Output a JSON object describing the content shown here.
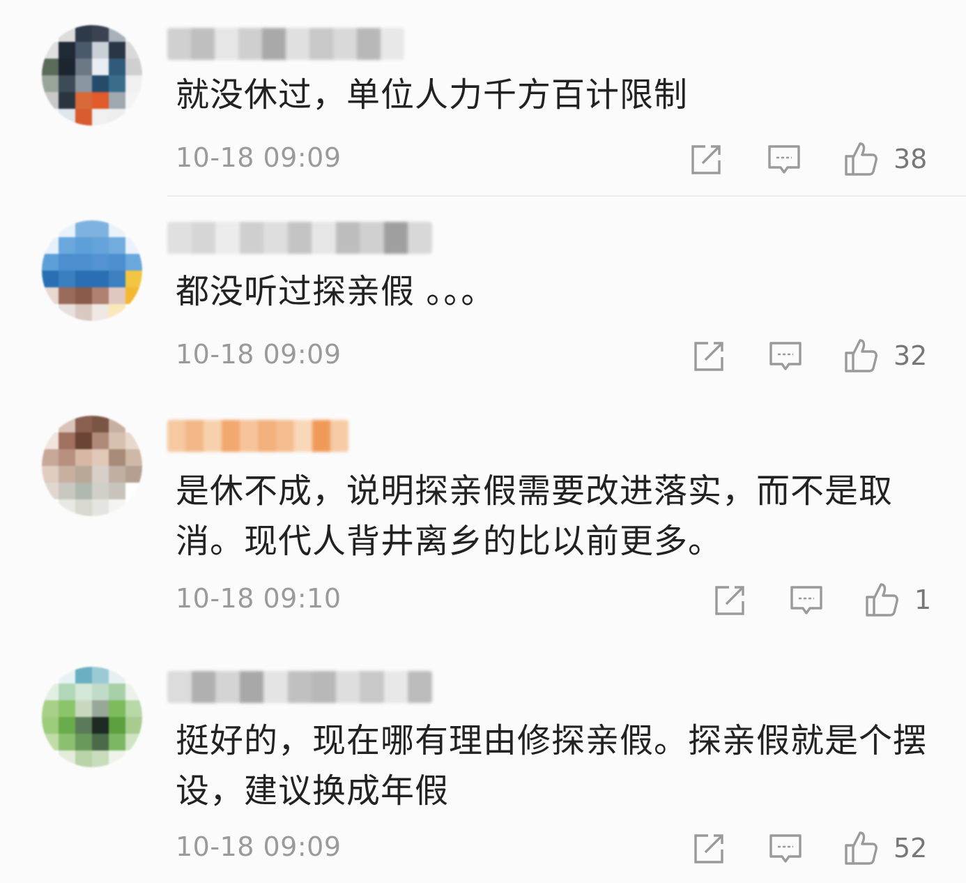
{
  "comments": [
    {
      "username": "",
      "text": "就没休过，单位人力千方百计限制",
      "timestamp": "10-18 09:09",
      "likes": "38",
      "avatar_colors": [
        "#ffffff",
        "#dcdcdc",
        "#2e3a4a",
        "#3b4252",
        "#a8b0b8",
        "#f2f2f2",
        "#e0e0e0",
        "#1f2a36",
        "#4a5a6a",
        "#c8d0d8",
        "#2a3644",
        "#d9d9d9",
        "#5a6b5a",
        "#1c2530",
        "#6c7884",
        "#e8eef2",
        "#2f5a7a",
        "#cfcfcf",
        "#9aa59a",
        "#3d4b58",
        "#8a96a2",
        "#254b6b",
        "#3a6d8a",
        "#f0f0f0",
        "#c9c9c9",
        "#2b3540",
        "#d86a3a",
        "#e05a2a",
        "#a0a8b0",
        "#f4f4f4",
        "#f5f5f5",
        "#dfe6ec",
        "#d85c30",
        "#f0f0f0",
        "#eeeeee",
        "#ffffff"
      ],
      "name_colors": [
        "#d0d0d0",
        "#bfbfbf",
        "#e6e6e6",
        "#cfcfcf",
        "#a9a9a9",
        "#e0e0e0",
        "#c8c8c8",
        "#d9d9d9",
        "#b8b8b8",
        "#e8e8e8"
      ],
      "name_width": 340
    },
    {
      "username": "",
      "text": "都没听过探亲假 。。。",
      "timestamp": "10-18 09:09",
      "likes": "32",
      "avatar_colors": [
        "#ffffff",
        "#eaf3fb",
        "#7fb3df",
        "#7fb3df",
        "#eaf3fb",
        "#ffffff",
        "#e8f1fa",
        "#6aa7dc",
        "#5d9fd8",
        "#64a4da",
        "#72acdd",
        "#eaf3fb",
        "#5d9fd8",
        "#4b8fcf",
        "#4b8fcf",
        "#5393d1",
        "#4b8fcf",
        "#6aa7dc",
        "#2a6fb3",
        "#3a7fbf",
        "#2a6fb3",
        "#2a6fb3",
        "#3d80c0",
        "#f2c640",
        "#e8d8d0",
        "#9a6a5a",
        "#8a5a4a",
        "#b08070",
        "#e0c8c0",
        "#f4b830",
        "#ffffff",
        "#e8e0dc",
        "#d8c8c0",
        "#f0e8e4",
        "#fbe8b8",
        "#ffffff"
      ],
      "name_colors": [
        "#e0e0e0",
        "#d6d6d6",
        "#ececec",
        "#cfcfcf",
        "#dedede",
        "#c4c4c4",
        "#e6e6e6",
        "#bdbdbd",
        "#d0d0d0",
        "#9f9f9f",
        "#d8d8d8"
      ],
      "name_width": 380
    },
    {
      "username": "",
      "text": "是休不成，说明探亲假需要改进落实，而不是取消。现代人背井离乡的比以前更多。",
      "timestamp": "10-18 09:10",
      "likes": "1",
      "avatar_colors": [
        "#ffffff",
        "#d8c4b8",
        "#8a6050",
        "#7a5444",
        "#c8b0a0",
        "#ffffff",
        "#f0e4dc",
        "#a07060",
        "#6a4434",
        "#b08a78",
        "#d8c0b0",
        "#e8d8cc",
        "#c8a898",
        "#b89080",
        "#d8b8a4",
        "#e0c8b8",
        "#a88a78",
        "#d0b8a8",
        "#e0ccc0",
        "#c8b0a0",
        "#b8a898",
        "#d8d0c8",
        "#c0b0a4",
        "#b4a090",
        "#e0d8d0",
        "#c8c8c0",
        "#b0b8b0",
        "#d0d0c8",
        "#c8c4bc",
        "#ffffff",
        "#ffffff",
        "#e8e8e4",
        "#d8d8d0",
        "#e4e4e0",
        "#f4f4f2",
        "#ffffff"
      ],
      "name_colors": [
        "#f6c9a0",
        "#f3b787",
        "#f7d1ad",
        "#f2a86e",
        "#f6c49b",
        "#f1b07c",
        "#f4bd91",
        "#f8d8b8",
        "#f09a5a",
        "#f6cba6"
      ],
      "name_width": 260
    },
    {
      "username": "",
      "text": "挺好的，现在哪有理由修探亲假。探亲假就是个摆设，建议换成年假",
      "timestamp": "10-18 09:09",
      "likes": "52",
      "avatar_colors": [
        "#ffffff",
        "#e8f2f4",
        "#6ab0c0",
        "#9ccad4",
        "#e6f0f2",
        "#ffffff",
        "#e4efe4",
        "#b0d8b8",
        "#d4e8d8",
        "#c0dcc8",
        "#a8d0a8",
        "#eaf2ea",
        "#a8d088",
        "#8cc46c",
        "#c8d8c0",
        "#98a898",
        "#7cbc5c",
        "#b8d8a8",
        "#9ccc7c",
        "#6aac4c",
        "#5a7a5a",
        "#1e2a24",
        "#5ca040",
        "#a8cc90",
        "#c0dca8",
        "#8cc070",
        "#6a9a5a",
        "#4a6a4a",
        "#7cb864",
        "#d0e4c4",
        "#ffffff",
        "#e4ecdc",
        "#b8d4a8",
        "#c8dcbc",
        "#eef4ea",
        "#ffffff"
      ],
      "name_colors": [
        "#dcdcdc",
        "#b0b0b0",
        "#d4d4d4",
        "#a8a8a8",
        "#e4e4e4",
        "#c0c0c0",
        "#b8b8b8",
        "#dedede",
        "#c8c8c8",
        "#e8e8e8",
        "#bcbcbc"
      ],
      "name_width": 380
    }
  ]
}
